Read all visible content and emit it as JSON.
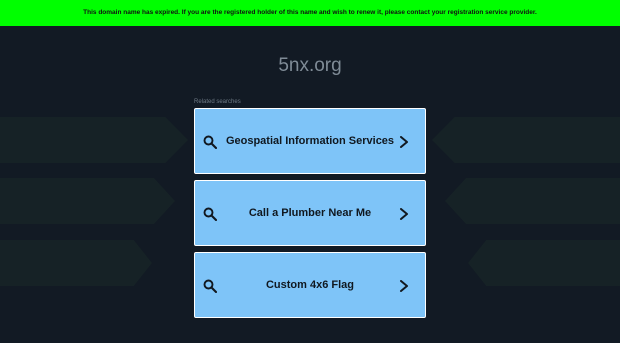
{
  "banner": {
    "text": "This domain name has expired. If you are the registered holder of this name and wish to renew it, please contact your registration service provider."
  },
  "domain": "5nx.org",
  "related": {
    "heading": "Related searches",
    "items": [
      {
        "label": "Geospatial Information Services",
        "icon": "search-icon",
        "arrow": "chevron-right-icon"
      },
      {
        "label": "Call a Plumber Near Me",
        "icon": "search-icon",
        "arrow": "chevron-right-icon"
      },
      {
        "label": "Custom 4x6 Flag",
        "icon": "search-icon",
        "arrow": "chevron-right-icon"
      }
    ]
  },
  "colors": {
    "background": "#121a24",
    "banner": "#00ff00",
    "item": "#7ec4f8",
    "decor": "#162226"
  }
}
